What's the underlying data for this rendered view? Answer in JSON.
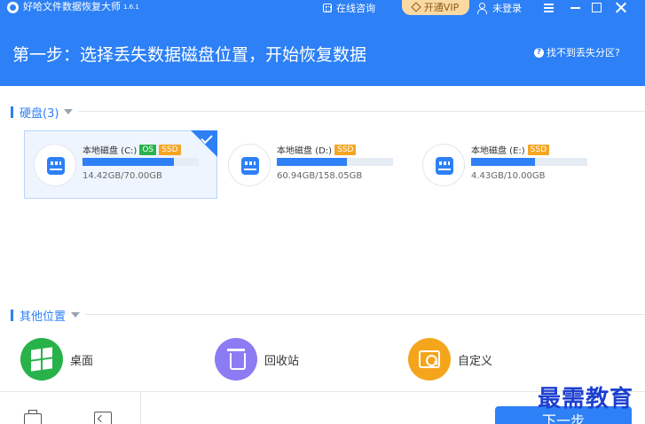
{
  "app": {
    "title": "好哈文件数据恢复大师",
    "version": "1.6.1",
    "consult_label": "在线咨询",
    "vip_label": "开通VIP",
    "login_label": "未登录"
  },
  "header": {
    "step_title": "第一步：选择丢失数据磁盘位置，开始恢复数据",
    "help_label": "找不到丢失分区?"
  },
  "disks_section": {
    "title": "硬盘(3)",
    "disks": [
      {
        "name": "本地磁盘 (C:)",
        "badges": [
          "OS",
          "SSD"
        ],
        "size_text": "14.42GB/70.00GB",
        "used_fraction": 0.79,
        "selected": true
      },
      {
        "name": "本地磁盘 (D:)",
        "badges": [
          "SSD"
        ],
        "size_text": "60.94GB/158.05GB",
        "used_fraction": 0.6,
        "selected": false
      },
      {
        "name": "本地磁盘 (E:)",
        "badges": [
          "SSD"
        ],
        "size_text": "4.43GB/10.00GB",
        "used_fraction": 0.55,
        "selected": false
      }
    ]
  },
  "other_section": {
    "title": "其他位置",
    "locations": [
      {
        "label": "桌面",
        "icon": "windows-icon",
        "color": "#28b24a"
      },
      {
        "label": "回收站",
        "icon": "trash-icon",
        "color": "#8b7cf3"
      },
      {
        "label": "自定义",
        "icon": "folder-search-icon",
        "color": "#f4a51c"
      }
    ]
  },
  "footer": {
    "next_label": "下一步"
  },
  "watermark": "最需教育",
  "colors": {
    "primary": "#2d80f6",
    "vip": "#fbd9a3",
    "os_badge": "#2bb24c",
    "ssd_badge": "#f5a623"
  }
}
